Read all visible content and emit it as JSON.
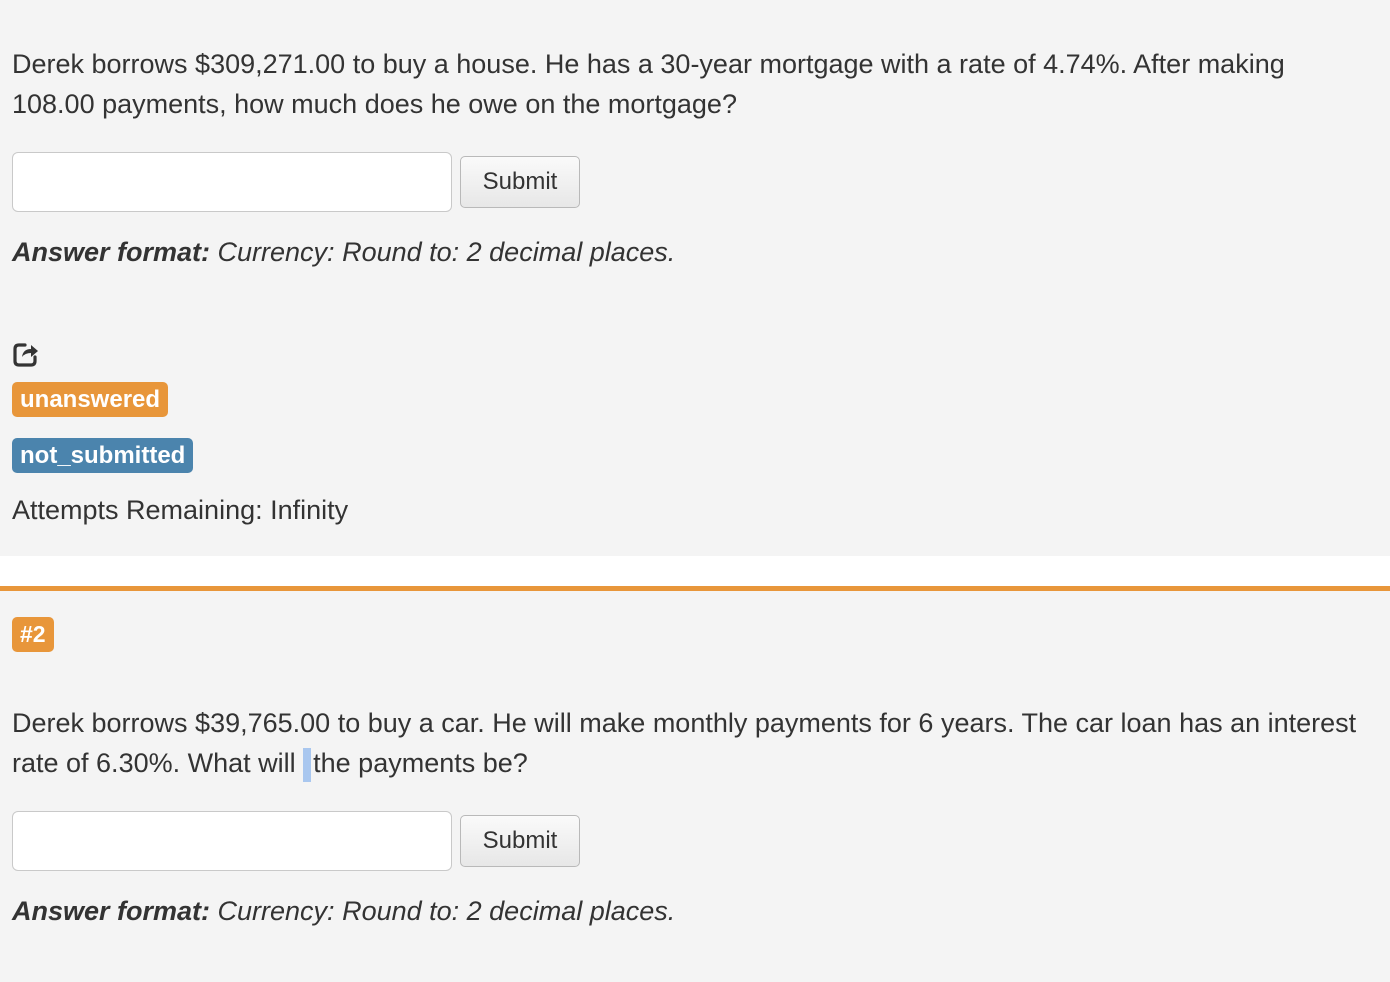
{
  "questions": [
    {
      "text": "Derek borrows $309,271.00 to buy a house. He has a 30-year mortgage with a rate of 4.74%. After making 108.00 payments, how much does he owe on the mortgage?",
      "input_value": "",
      "submit_label": "Submit",
      "format_label": "Answer format:",
      "format_text": " Currency: Round to: 2 decimal places.",
      "status_badges": [
        "unanswered",
        "not_submitted"
      ],
      "attempts": "Attempts Remaining: Infinity",
      "share_icon": "share-icon"
    },
    {
      "number": "#2",
      "text_before": "Derek borrows $39,765.00 to buy a car. He will make monthly payments for 6 years. The car loan has an interest rate of 6.30%. What will",
      "text_after": "the payments be?",
      "input_value": "",
      "submit_label": "Submit",
      "format_label": "Answer format:",
      "format_text": " Currency: Round to: 2 decimal places."
    }
  ],
  "colors": {
    "accent_orange": "#e8963a",
    "badge_blue": "#4b84ad",
    "panel_bg": "#f4f4f4"
  }
}
